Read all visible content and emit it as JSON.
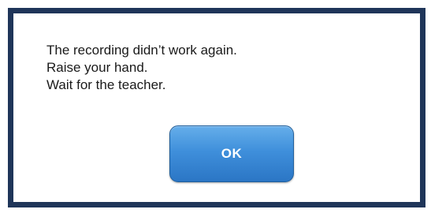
{
  "dialog": {
    "message_lines": [
      "The recording didn’t work again.",
      "Raise your hand.",
      "Wait for the teacher."
    ],
    "ok_button": {
      "label": "OK"
    }
  },
  "colors": {
    "border": "#1f3559",
    "button_top": "#65aeea",
    "button_bottom": "#2b76c5",
    "text": "#1a1a1a"
  }
}
